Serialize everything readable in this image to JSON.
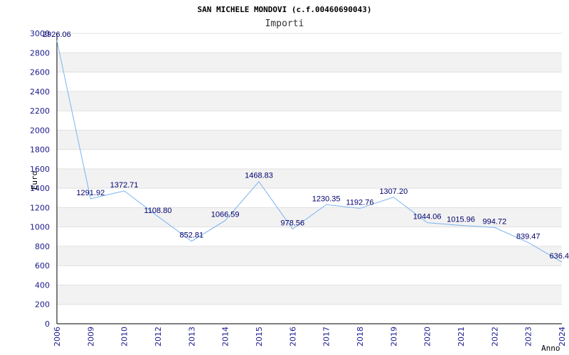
{
  "chart_data": {
    "type": "line",
    "title": "SAN MICHELE MONDOVI (c.f.00460690043)",
    "subtitle": "Importi",
    "xlabel": "Anno",
    "ylabel": "Euro",
    "categories": [
      "2006",
      "2009",
      "2010",
      "2012",
      "2013",
      "2014",
      "2015",
      "2016",
      "2017",
      "2018",
      "2019",
      "2020",
      "2021",
      "2022",
      "2023",
      "2024"
    ],
    "values": [
      2926.06,
      1291.92,
      1372.71,
      1108.8,
      852.81,
      1066.59,
      1468.83,
      978.56,
      1230.35,
      1192.76,
      1307.2,
      1044.06,
      1015.96,
      994.72,
      839.47,
      636.4
    ],
    "value_labels": [
      "2926.06",
      "1291.92",
      "1372.71",
      "1108.80",
      "852.81",
      "1066.59",
      "1468.83",
      "978.56",
      "1230.35",
      "1192.76",
      "1307.20",
      "1044.06",
      "1015.96",
      "994.72",
      "839.47",
      "636.4"
    ],
    "ylim": [
      0,
      3000
    ],
    "yticks": [
      0,
      200,
      400,
      600,
      800,
      1000,
      1200,
      1400,
      1600,
      1800,
      2000,
      2200,
      2400,
      2600,
      2800,
      3000
    ],
    "grid": true,
    "colors": {
      "line": "#7ab4f0",
      "band": "#f2f2f2",
      "gridline": "#e0e0e0",
      "tick_text": "#1a1a8c",
      "label_text": "#00006e"
    }
  }
}
